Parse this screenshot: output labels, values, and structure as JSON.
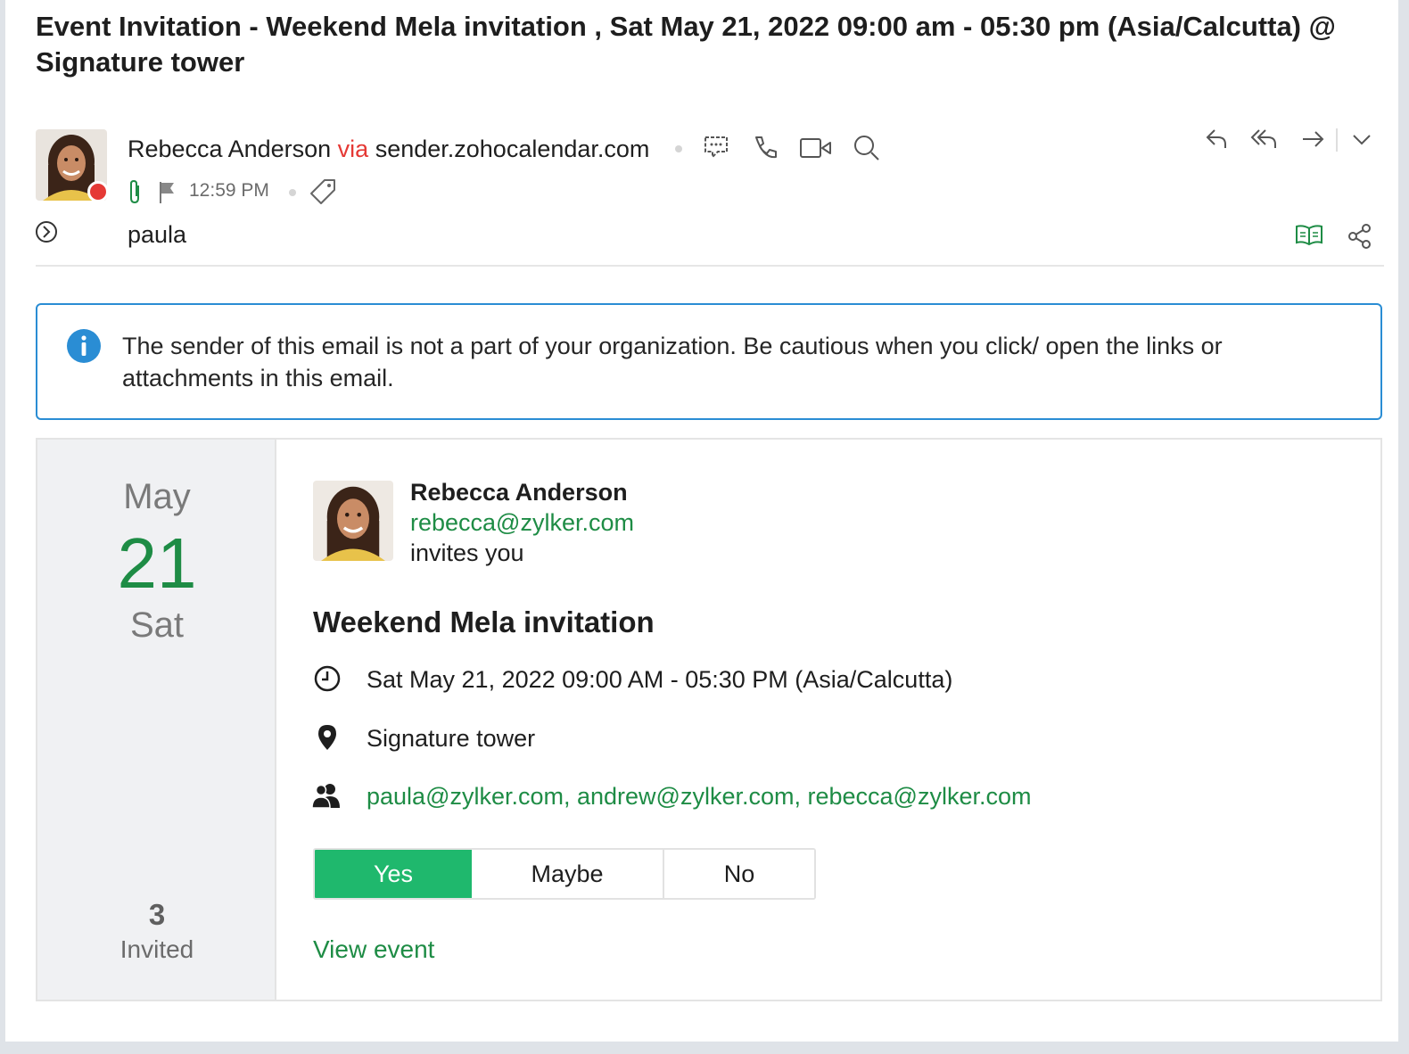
{
  "email": {
    "subject": "Event Invitation - Weekend Mela invitation , Sat May 21, 2022 09:00 am - 05:30 pm (Asia/Calcutta)  @ Signature tower",
    "sender_name": "Rebecca Anderson",
    "via_label": "via",
    "via_domain": "sender.zohocalendar.com",
    "time": "12:59 PM",
    "to": "paula",
    "header_icons": [
      "chat-icon",
      "phone-icon",
      "video-icon",
      "search-icon",
      "attachment-icon",
      "flag-icon",
      "tag-icon",
      "expand-details-icon",
      "reply-icon",
      "reply-all-icon",
      "forward-icon",
      "more-dropdown-icon",
      "reading-mode-icon",
      "share-icon"
    ],
    "presence_color": "#e53935"
  },
  "notice": {
    "text": "The sender of this email is not a part of your organization. Be cautious when you click/ open the links or attachments in this email.",
    "icon": "info-icon",
    "accent": "#2a8dd4"
  },
  "invite": {
    "month": "May",
    "day": "21",
    "weekday": "Sat",
    "invited_count": "3",
    "invited_label": "Invited",
    "host_name": "Rebecca Anderson",
    "host_email": "rebecca@zylker.com",
    "invites_text": "invites you",
    "title": "Weekend Mela invitation",
    "datetime": "Sat May 21, 2022 09:00 AM - 05:30 PM (Asia/Calcutta)",
    "location": "Signature tower",
    "attendees": "paula@zylker.com, andrew@zylker.com, rebecca@zylker.com",
    "rsvp": {
      "yes": "Yes",
      "maybe": "Maybe",
      "no": "No",
      "selected": "Yes"
    },
    "view_event": "View event",
    "accent_green": "#1e8c45",
    "yes_color": "#1fb86d"
  }
}
